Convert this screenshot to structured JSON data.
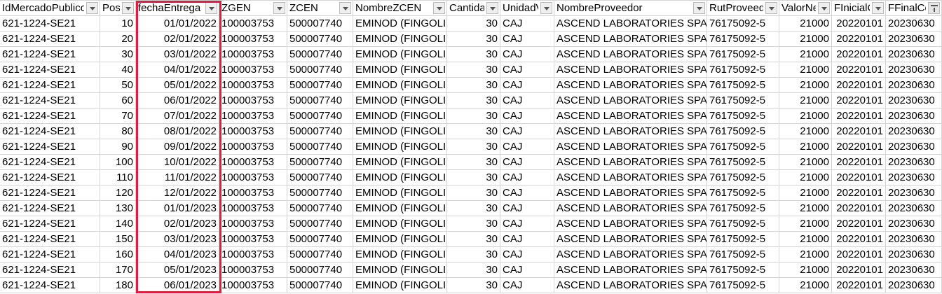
{
  "colors": {
    "highlight": "#e11d3f",
    "gridline": "#d4d4d4"
  },
  "columns": [
    {
      "label": "IdMercadoPublico",
      "key": "id",
      "align": "left"
    },
    {
      "label": "Pos",
      "key": "pos",
      "align": "right"
    },
    {
      "label": "fechaEntrega",
      "key": "fecha",
      "align": "right"
    },
    {
      "label": "ZGEN",
      "key": "zgen",
      "align": "left"
    },
    {
      "label": "ZCEN",
      "key": "zcen",
      "align": "left"
    },
    {
      "label": "NombreZCEN",
      "key": "nombre_zcen",
      "align": "left"
    },
    {
      "label": "Cantidad",
      "key": "cantidad",
      "align": "right"
    },
    {
      "label": "UnidadVenta",
      "key": "unidad",
      "align": "left"
    },
    {
      "label": "NombreProveedor",
      "key": "proveedor",
      "align": "left"
    },
    {
      "label": "RutProveedor",
      "key": "rut",
      "align": "left"
    },
    {
      "label": "ValorNeto",
      "key": "valor",
      "align": "right"
    },
    {
      "label": "FInicialContrato",
      "key": "finicial",
      "align": "right"
    },
    {
      "label": "FFinalContrato",
      "key": "ffinal",
      "align": "left",
      "filter_active": true
    }
  ],
  "rows": [
    {
      "id": "621-1224-SE21",
      "pos": "10",
      "fecha": "01/01/2022",
      "zgen": "100003753",
      "zcen": "500007740",
      "nombre_zcen": "EMINOD (FINGOLIMOD)",
      "cantidad": "30",
      "unidad": "CAJ",
      "proveedor": "ASCEND LABORATORIES SPA",
      "rut": "76175092-5",
      "valor": "21000",
      "finicial": "20220101",
      "ffinal": "20230630"
    },
    {
      "id": "621-1224-SE21",
      "pos": "20",
      "fecha": "02/01/2022",
      "zgen": "100003753",
      "zcen": "500007740",
      "nombre_zcen": "EMINOD (FINGOLIMOD)",
      "cantidad": "30",
      "unidad": "CAJ",
      "proveedor": "ASCEND LABORATORIES SPA",
      "rut": "76175092-5",
      "valor": "21000",
      "finicial": "20220101",
      "ffinal": "20230630"
    },
    {
      "id": "621-1224-SE21",
      "pos": "30",
      "fecha": "03/01/2022",
      "zgen": "100003753",
      "zcen": "500007740",
      "nombre_zcen": "EMINOD (FINGOLIMOD)",
      "cantidad": "30",
      "unidad": "CAJ",
      "proveedor": "ASCEND LABORATORIES SPA",
      "rut": "76175092-5",
      "valor": "21000",
      "finicial": "20220101",
      "ffinal": "20230630"
    },
    {
      "id": "621-1224-SE21",
      "pos": "40",
      "fecha": "04/01/2022",
      "zgen": "100003753",
      "zcen": "500007740",
      "nombre_zcen": "EMINOD (FINGOLIMOD)",
      "cantidad": "30",
      "unidad": "CAJ",
      "proveedor": "ASCEND LABORATORIES SPA",
      "rut": "76175092-5",
      "valor": "21000",
      "finicial": "20220101",
      "ffinal": "20230630"
    },
    {
      "id": "621-1224-SE21",
      "pos": "50",
      "fecha": "05/01/2022",
      "zgen": "100003753",
      "zcen": "500007740",
      "nombre_zcen": "EMINOD (FINGOLIMOD)",
      "cantidad": "30",
      "unidad": "CAJ",
      "proveedor": "ASCEND LABORATORIES SPA",
      "rut": "76175092-5",
      "valor": "21000",
      "finicial": "20220101",
      "ffinal": "20230630"
    },
    {
      "id": "621-1224-SE21",
      "pos": "60",
      "fecha": "06/01/2022",
      "zgen": "100003753",
      "zcen": "500007740",
      "nombre_zcen": "EMINOD (FINGOLIMOD)",
      "cantidad": "30",
      "unidad": "CAJ",
      "proveedor": "ASCEND LABORATORIES SPA",
      "rut": "76175092-5",
      "valor": "21000",
      "finicial": "20220101",
      "ffinal": "20230630"
    },
    {
      "id": "621-1224-SE21",
      "pos": "70",
      "fecha": "07/01/2022",
      "zgen": "100003753",
      "zcen": "500007740",
      "nombre_zcen": "EMINOD (FINGOLIMOD)",
      "cantidad": "30",
      "unidad": "CAJ",
      "proveedor": "ASCEND LABORATORIES SPA",
      "rut": "76175092-5",
      "valor": "21000",
      "finicial": "20220101",
      "ffinal": "20230630"
    },
    {
      "id": "621-1224-SE21",
      "pos": "80",
      "fecha": "08/01/2022",
      "zgen": "100003753",
      "zcen": "500007740",
      "nombre_zcen": "EMINOD (FINGOLIMOD)",
      "cantidad": "30",
      "unidad": "CAJ",
      "proveedor": "ASCEND LABORATORIES SPA",
      "rut": "76175092-5",
      "valor": "21000",
      "finicial": "20220101",
      "ffinal": "20230630"
    },
    {
      "id": "621-1224-SE21",
      "pos": "90",
      "fecha": "09/01/2022",
      "zgen": "100003753",
      "zcen": "500007740",
      "nombre_zcen": "EMINOD (FINGOLIMOD)",
      "cantidad": "30",
      "unidad": "CAJ",
      "proveedor": "ASCEND LABORATORIES SPA",
      "rut": "76175092-5",
      "valor": "21000",
      "finicial": "20220101",
      "ffinal": "20230630"
    },
    {
      "id": "621-1224-SE21",
      "pos": "100",
      "fecha": "10/01/2022",
      "zgen": "100003753",
      "zcen": "500007740",
      "nombre_zcen": "EMINOD (FINGOLIMOD)",
      "cantidad": "30",
      "unidad": "CAJ",
      "proveedor": "ASCEND LABORATORIES SPA",
      "rut": "76175092-5",
      "valor": "21000",
      "finicial": "20220101",
      "ffinal": "20230630"
    },
    {
      "id": "621-1224-SE21",
      "pos": "110",
      "fecha": "11/01/2022",
      "zgen": "100003753",
      "zcen": "500007740",
      "nombre_zcen": "EMINOD (FINGOLIMOD)",
      "cantidad": "30",
      "unidad": "CAJ",
      "proveedor": "ASCEND LABORATORIES SPA",
      "rut": "76175092-5",
      "valor": "21000",
      "finicial": "20220101",
      "ffinal": "20230630"
    },
    {
      "id": "621-1224-SE21",
      "pos": "120",
      "fecha": "12/01/2022",
      "zgen": "100003753",
      "zcen": "500007740",
      "nombre_zcen": "EMINOD (FINGOLIMOD)",
      "cantidad": "30",
      "unidad": "CAJ",
      "proveedor": "ASCEND LABORATORIES SPA",
      "rut": "76175092-5",
      "valor": "21000",
      "finicial": "20220101",
      "ffinal": "20230630"
    },
    {
      "id": "621-1224-SE21",
      "pos": "130",
      "fecha": "01/01/2023",
      "zgen": "100003753",
      "zcen": "500007740",
      "nombre_zcen": "EMINOD (FINGOLIMOD)",
      "cantidad": "30",
      "unidad": "CAJ",
      "proveedor": "ASCEND LABORATORIES SPA",
      "rut": "76175092-5",
      "valor": "21000",
      "finicial": "20220101",
      "ffinal": "20230630"
    },
    {
      "id": "621-1224-SE21",
      "pos": "140",
      "fecha": "02/01/2023",
      "zgen": "100003753",
      "zcen": "500007740",
      "nombre_zcen": "EMINOD (FINGOLIMOD)",
      "cantidad": "30",
      "unidad": "CAJ",
      "proveedor": "ASCEND LABORATORIES SPA",
      "rut": "76175092-5",
      "valor": "21000",
      "finicial": "20220101",
      "ffinal": "20230630"
    },
    {
      "id": "621-1224-SE21",
      "pos": "150",
      "fecha": "03/01/2023",
      "zgen": "100003753",
      "zcen": "500007740",
      "nombre_zcen": "EMINOD (FINGOLIMOD)",
      "cantidad": "30",
      "unidad": "CAJ",
      "proveedor": "ASCEND LABORATORIES SPA",
      "rut": "76175092-5",
      "valor": "21000",
      "finicial": "20220101",
      "ffinal": "20230630"
    },
    {
      "id": "621-1224-SE21",
      "pos": "160",
      "fecha": "04/01/2023",
      "zgen": "100003753",
      "zcen": "500007740",
      "nombre_zcen": "EMINOD (FINGOLIMOD)",
      "cantidad": "30",
      "unidad": "CAJ",
      "proveedor": "ASCEND LABORATORIES SPA",
      "rut": "76175092-5",
      "valor": "21000",
      "finicial": "20220101",
      "ffinal": "20230630"
    },
    {
      "id": "621-1224-SE21",
      "pos": "170",
      "fecha": "05/01/2023",
      "zgen": "100003753",
      "zcen": "500007740",
      "nombre_zcen": "EMINOD (FINGOLIMOD)",
      "cantidad": "30",
      "unidad": "CAJ",
      "proveedor": "ASCEND LABORATORIES SPA",
      "rut": "76175092-5",
      "valor": "21000",
      "finicial": "20220101",
      "ffinal": "20230630"
    },
    {
      "id": "621-1224-SE21",
      "pos": "180",
      "fecha": "06/01/2023",
      "zgen": "100003753",
      "zcen": "500007740",
      "nombre_zcen": "EMINOD (FINGOLIMOD)",
      "cantidad": "30",
      "unidad": "CAJ",
      "proveedor": "ASCEND LABORATORIES SPA",
      "rut": "76175092-5",
      "valor": "21000",
      "finicial": "20220101",
      "ffinal": "20230630"
    }
  ]
}
